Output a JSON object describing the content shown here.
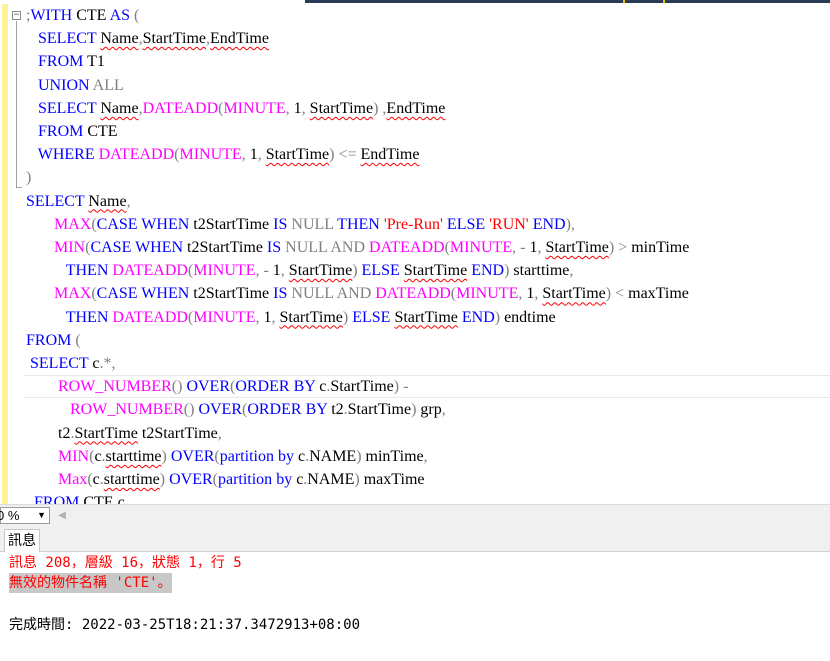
{
  "editor": {
    "outline_toggle": "−",
    "lines": [
      [
        {
          "t": ";",
          "c": "gr"
        },
        {
          "t": "WITH",
          "c": "kw"
        },
        {
          "t": " CTE "
        },
        {
          "t": "AS",
          "c": "kw"
        },
        {
          "t": " (",
          "c": "gr"
        }
      ],
      [
        {
          "t": "   "
        },
        {
          "t": "SELECT",
          "c": "kw"
        },
        {
          "t": " "
        },
        {
          "t": "Name",
          "c": "sq"
        },
        {
          "t": ",",
          "c": "gr"
        },
        {
          "t": "StartTime",
          "c": "sq"
        },
        {
          "t": ",",
          "c": "gr"
        },
        {
          "t": "EndTime",
          "c": "sq"
        }
      ],
      [
        {
          "t": "   "
        },
        {
          "t": "FROM",
          "c": "kw"
        },
        {
          "t": " T1"
        }
      ],
      [
        {
          "t": "   "
        },
        {
          "t": "UNION",
          "c": "kw"
        },
        {
          "t": " "
        },
        {
          "t": "ALL",
          "c": "gr"
        }
      ],
      [
        {
          "t": "   "
        },
        {
          "t": "SELECT",
          "c": "kw"
        },
        {
          "t": " "
        },
        {
          "t": "Name",
          "c": "sq"
        },
        {
          "t": ",",
          "c": "gr"
        },
        {
          "t": "DATEADD",
          "c": "fn"
        },
        {
          "t": "(",
          "c": "gr"
        },
        {
          "t": "MINUTE",
          "c": "fn"
        },
        {
          "t": ",",
          "c": "gr"
        },
        {
          "t": " 1"
        },
        {
          "t": ",",
          "c": "gr"
        },
        {
          "t": " "
        },
        {
          "t": "StartTime",
          "c": "sq"
        },
        {
          "t": ")",
          "c": "gr"
        },
        {
          "t": " "
        },
        {
          "t": ",",
          "c": "gr"
        },
        {
          "t": "EndTime",
          "c": "sq"
        }
      ],
      [
        {
          "t": "   "
        },
        {
          "t": "FROM",
          "c": "kw"
        },
        {
          "t": " CTE"
        }
      ],
      [
        {
          "t": "   "
        },
        {
          "t": "WHERE",
          "c": "kw"
        },
        {
          "t": " "
        },
        {
          "t": "DATEADD",
          "c": "fn"
        },
        {
          "t": "(",
          "c": "gr"
        },
        {
          "t": "MINUTE",
          "c": "fn"
        },
        {
          "t": ",",
          "c": "gr"
        },
        {
          "t": " 1"
        },
        {
          "t": ",",
          "c": "gr"
        },
        {
          "t": " "
        },
        {
          "t": "StartTime",
          "c": "sq"
        },
        {
          "t": ")",
          "c": "gr"
        },
        {
          "t": " "
        },
        {
          "t": "<=",
          "c": "gr"
        },
        {
          "t": " "
        },
        {
          "t": "EndTime",
          "c": "sq"
        }
      ],
      [
        {
          "t": ")",
          "c": "gr"
        }
      ],
      [
        {
          "t": "SELECT",
          "c": "kw"
        },
        {
          "t": " "
        },
        {
          "t": "Name",
          "c": "sq"
        },
        {
          "t": ",",
          "c": "gr"
        }
      ],
      [
        {
          "t": "       "
        },
        {
          "t": "MAX",
          "c": "fn"
        },
        {
          "t": "(",
          "c": "gr"
        },
        {
          "t": "CASE",
          "c": "kw"
        },
        {
          "t": " "
        },
        {
          "t": "WHEN",
          "c": "kw"
        },
        {
          "t": " t2StartTime "
        },
        {
          "t": "IS",
          "c": "kw"
        },
        {
          "t": " "
        },
        {
          "t": "NULL",
          "c": "gr"
        },
        {
          "t": " "
        },
        {
          "t": "THEN",
          "c": "kw"
        },
        {
          "t": " "
        },
        {
          "t": "'Pre-Run'",
          "c": "st"
        },
        {
          "t": " "
        },
        {
          "t": "ELSE",
          "c": "kw"
        },
        {
          "t": " "
        },
        {
          "t": "'RUN'",
          "c": "st"
        },
        {
          "t": " "
        },
        {
          "t": "END",
          "c": "kw"
        },
        {
          "t": "),",
          "c": "gr"
        }
      ],
      [
        {
          "t": "       "
        },
        {
          "t": "MIN",
          "c": "fn"
        },
        {
          "t": "(",
          "c": "gr"
        },
        {
          "t": "CASE",
          "c": "kw"
        },
        {
          "t": " "
        },
        {
          "t": "WHEN",
          "c": "kw"
        },
        {
          "t": " t2StartTime "
        },
        {
          "t": "IS",
          "c": "kw"
        },
        {
          "t": " "
        },
        {
          "t": "NULL",
          "c": "gr"
        },
        {
          "t": " "
        },
        {
          "t": "AND",
          "c": "gr"
        },
        {
          "t": " "
        },
        {
          "t": "DATEADD",
          "c": "fn"
        },
        {
          "t": "(",
          "c": "gr"
        },
        {
          "t": "MINUTE",
          "c": "fn"
        },
        {
          "t": ",",
          "c": "gr"
        },
        {
          "t": " "
        },
        {
          "t": "-",
          "c": "gr"
        },
        {
          "t": " 1"
        },
        {
          "t": ",",
          "c": "gr"
        },
        {
          "t": " "
        },
        {
          "t": "StartTime",
          "c": "sq"
        },
        {
          "t": ")",
          "c": "gr"
        },
        {
          "t": " "
        },
        {
          "t": ">",
          "c": "gr"
        },
        {
          "t": " minTime"
        }
      ],
      [
        {
          "t": "          "
        },
        {
          "t": "THEN",
          "c": "kw"
        },
        {
          "t": " "
        },
        {
          "t": "DATEADD",
          "c": "fn"
        },
        {
          "t": "(",
          "c": "gr"
        },
        {
          "t": "MINUTE",
          "c": "fn"
        },
        {
          "t": ",",
          "c": "gr"
        },
        {
          "t": " "
        },
        {
          "t": "-",
          "c": "gr"
        },
        {
          "t": " 1"
        },
        {
          "t": ",",
          "c": "gr"
        },
        {
          "t": " "
        },
        {
          "t": "StartTime",
          "c": "sq"
        },
        {
          "t": ")",
          "c": "gr"
        },
        {
          "t": " "
        },
        {
          "t": "ELSE",
          "c": "kw"
        },
        {
          "t": " "
        },
        {
          "t": "StartTime",
          "c": "sq"
        },
        {
          "t": " "
        },
        {
          "t": "END",
          "c": "kw"
        },
        {
          "t": ")",
          "c": "gr"
        },
        {
          "t": " starttime"
        },
        {
          "t": ",",
          "c": "gr"
        }
      ],
      [
        {
          "t": "       "
        },
        {
          "t": "MAX",
          "c": "fn"
        },
        {
          "t": "(",
          "c": "gr"
        },
        {
          "t": "CASE",
          "c": "kw"
        },
        {
          "t": " "
        },
        {
          "t": "WHEN",
          "c": "kw"
        },
        {
          "t": " t2StartTime "
        },
        {
          "t": "IS",
          "c": "kw"
        },
        {
          "t": " "
        },
        {
          "t": "NULL",
          "c": "gr"
        },
        {
          "t": " "
        },
        {
          "t": "AND",
          "c": "gr"
        },
        {
          "t": " "
        },
        {
          "t": "DATEADD",
          "c": "fn"
        },
        {
          "t": "(",
          "c": "gr"
        },
        {
          "t": "MINUTE",
          "c": "fn"
        },
        {
          "t": ",",
          "c": "gr"
        },
        {
          "t": " 1"
        },
        {
          "t": ",",
          "c": "gr"
        },
        {
          "t": " "
        },
        {
          "t": "StartTime",
          "c": "sq"
        },
        {
          "t": ")",
          "c": "gr"
        },
        {
          "t": " "
        },
        {
          "t": "<",
          "c": "gr"
        },
        {
          "t": " maxTime"
        }
      ],
      [
        {
          "t": "          "
        },
        {
          "t": "THEN",
          "c": "kw"
        },
        {
          "t": " "
        },
        {
          "t": "DATEADD",
          "c": "fn"
        },
        {
          "t": "(",
          "c": "gr"
        },
        {
          "t": "MINUTE",
          "c": "fn"
        },
        {
          "t": ",",
          "c": "gr"
        },
        {
          "t": " 1"
        },
        {
          "t": ",",
          "c": "gr"
        },
        {
          "t": " "
        },
        {
          "t": "StartTime",
          "c": "sq"
        },
        {
          "t": ")",
          "c": "gr"
        },
        {
          "t": " "
        },
        {
          "t": "ELSE",
          "c": "kw"
        },
        {
          "t": " "
        },
        {
          "t": "StartTime",
          "c": "sq"
        },
        {
          "t": " "
        },
        {
          "t": "END",
          "c": "kw"
        },
        {
          "t": ")",
          "c": "gr"
        },
        {
          "t": " endtime"
        }
      ],
      [
        {
          "t": "FROM",
          "c": "kw"
        },
        {
          "t": " "
        },
        {
          "t": "(",
          "c": "gr"
        }
      ],
      [
        {
          "t": " "
        },
        {
          "t": "SELECT",
          "c": "kw"
        },
        {
          "t": " c"
        },
        {
          "t": ".*,",
          "c": "gr"
        }
      ],
      [
        {
          "t": "        "
        },
        {
          "t": "ROW_NUMBER",
          "c": "fn"
        },
        {
          "t": "()",
          "c": "gr"
        },
        {
          "t": " "
        },
        {
          "t": "OVER",
          "c": "kw"
        },
        {
          "t": "(",
          "c": "gr"
        },
        {
          "t": "ORDER",
          "c": "kw"
        },
        {
          "t": " "
        },
        {
          "t": "BY",
          "c": "kw"
        },
        {
          "t": " c"
        },
        {
          "t": ".",
          "c": "gr"
        },
        {
          "t": "StartTime"
        },
        {
          "t": ")",
          "c": "gr"
        },
        {
          "t": " "
        },
        {
          "t": "-",
          "c": "gr"
        }
      ],
      [
        {
          "t": "           "
        },
        {
          "t": "ROW_NUMBER",
          "c": "fn"
        },
        {
          "t": "()",
          "c": "gr"
        },
        {
          "t": " "
        },
        {
          "t": "OVER",
          "c": "kw"
        },
        {
          "t": "(",
          "c": "gr"
        },
        {
          "t": "ORDER",
          "c": "kw"
        },
        {
          "t": " "
        },
        {
          "t": "BY",
          "c": "kw"
        },
        {
          "t": " t2"
        },
        {
          "t": ".",
          "c": "gr"
        },
        {
          "t": "StartTime"
        },
        {
          "t": ")",
          "c": "gr"
        },
        {
          "t": " grp"
        },
        {
          "t": ",",
          "c": "gr"
        }
      ],
      [
        {
          "t": "        t2"
        },
        {
          "t": ".",
          "c": "gr"
        },
        {
          "t": "StartTime",
          "c": "sq"
        },
        {
          "t": " t2StartTime"
        },
        {
          "t": ",",
          "c": "gr"
        }
      ],
      [
        {
          "t": "        "
        },
        {
          "t": "MIN",
          "c": "fn"
        },
        {
          "t": "(",
          "c": "gr"
        },
        {
          "t": "c"
        },
        {
          "t": ".",
          "c": "gr"
        },
        {
          "t": "starttime",
          "c": "sq"
        },
        {
          "t": ")",
          "c": "gr"
        },
        {
          "t": " "
        },
        {
          "t": "OVER",
          "c": "kw"
        },
        {
          "t": "(",
          "c": "gr"
        },
        {
          "t": "partition",
          "c": "kw"
        },
        {
          "t": " "
        },
        {
          "t": "by",
          "c": "kw"
        },
        {
          "t": " c"
        },
        {
          "t": ".",
          "c": "gr"
        },
        {
          "t": "NAME"
        },
        {
          "t": ")",
          "c": "gr"
        },
        {
          "t": " minTime"
        },
        {
          "t": ",",
          "c": "gr"
        }
      ],
      [
        {
          "t": "        "
        },
        {
          "t": "Max",
          "c": "fn"
        },
        {
          "t": "(",
          "c": "gr"
        },
        {
          "t": "c"
        },
        {
          "t": ".",
          "c": "gr"
        },
        {
          "t": "starttime",
          "c": "sq"
        },
        {
          "t": ")",
          "c": "gr"
        },
        {
          "t": " "
        },
        {
          "t": "OVER",
          "c": "kw"
        },
        {
          "t": "(",
          "c": "gr"
        },
        {
          "t": "partition",
          "c": "kw"
        },
        {
          "t": " "
        },
        {
          "t": "by",
          "c": "kw"
        },
        {
          "t": " c"
        },
        {
          "t": ".",
          "c": "gr"
        },
        {
          "t": "NAME"
        },
        {
          "t": ")",
          "c": "gr"
        },
        {
          "t": " maxTime"
        }
      ],
      [
        {
          "t": "  "
        },
        {
          "t": "FROM",
          "c": "kw"
        },
        {
          "t": " CTE c"
        }
      ]
    ],
    "current_line_index": 16
  },
  "zoombar": {
    "zoom_value": "0 %",
    "dropdown_glyph": "▼",
    "scroll_left_glyph": "◀"
  },
  "results": {
    "tab_label": "訊息",
    "error_header": "訊息 208，層級 16，狀態 1，行 5",
    "error_text": "無效的物件名稱 'CTE'。",
    "completion": "完成時間: 2022-03-25T18:21:37.3472913+08:00"
  },
  "colors": {
    "keyword": "#0000ff",
    "function": "#ff00ff",
    "operator": "#808080",
    "string": "#ff0000",
    "error_text": "#ff0000",
    "change_bar": "#fbf299"
  }
}
